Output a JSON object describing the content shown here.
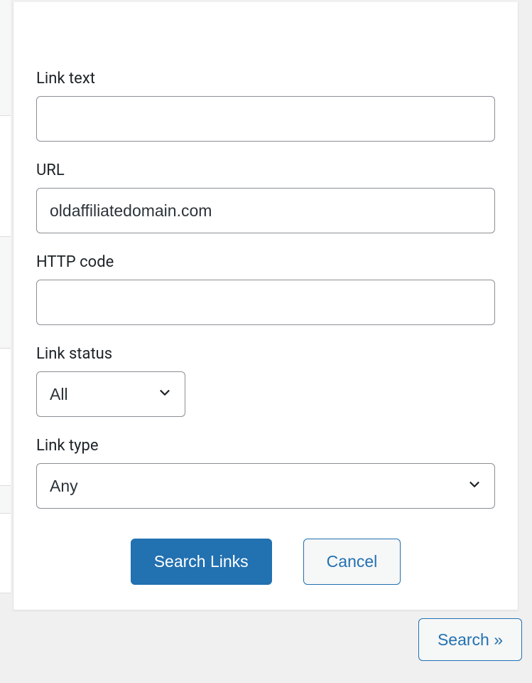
{
  "form": {
    "link_text": {
      "label": "Link text",
      "value": ""
    },
    "url": {
      "label": "URL",
      "value": "oldaffiliatedomain.com"
    },
    "http_code": {
      "label": "HTTP code",
      "value": ""
    },
    "link_status": {
      "label": "Link status",
      "value": "All"
    },
    "link_type": {
      "label": "Link type",
      "value": "Any"
    }
  },
  "buttons": {
    "search_links": "Search Links",
    "cancel": "Cancel",
    "outer_search": "Search »"
  }
}
